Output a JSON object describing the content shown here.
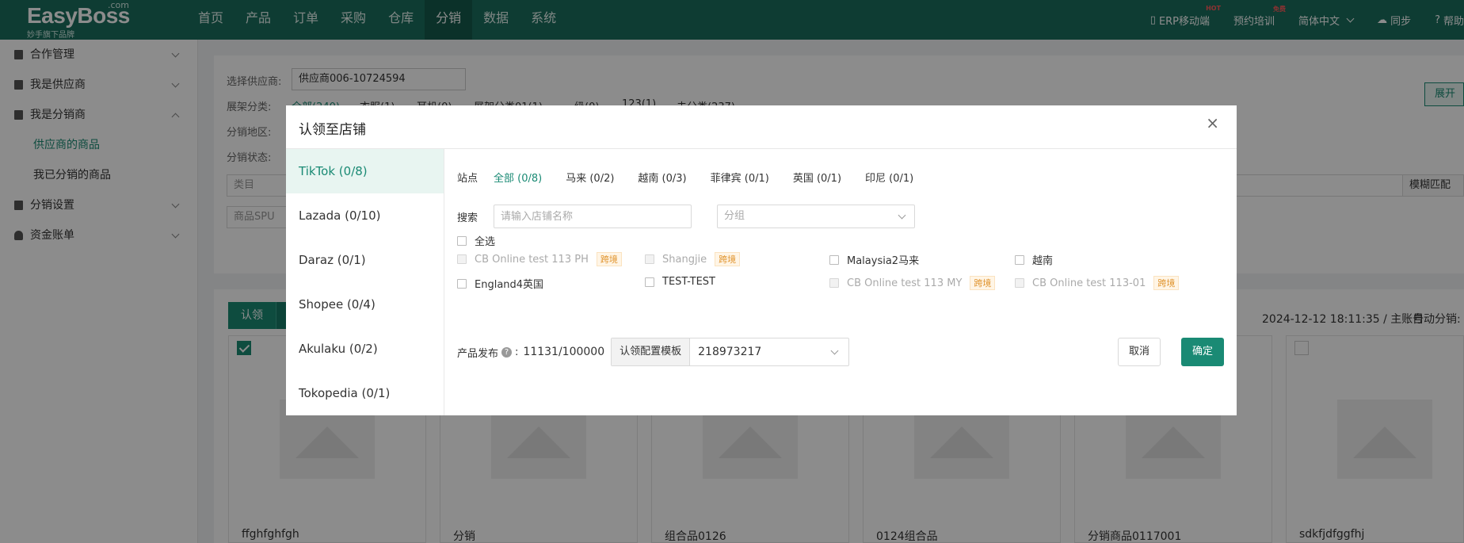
{
  "logo": {
    "brand": "EasyBoss",
    "com": ".com",
    "tagline": "妙手旗下品牌"
  },
  "nav": [
    "首页",
    "产品",
    "订单",
    "采购",
    "仓库",
    "分销",
    "数据",
    "系统"
  ],
  "nav_active": "分销",
  "topright": {
    "erp": "ERP移动端",
    "erp_badge": "HOT",
    "training": "预约培训",
    "training_badge": "免费",
    "language": "简体中文",
    "sync": "同步",
    "help": "帮助"
  },
  "sidebar": {
    "items": [
      {
        "label": "合作管理"
      },
      {
        "label": "我是供应商"
      },
      {
        "label": "我是分销商"
      },
      {
        "label": "分销设置"
      },
      {
        "label": "资金账单"
      }
    ],
    "sub_items": [
      "供应商的商品",
      "我已分销的商品"
    ]
  },
  "filters": {
    "supplier_label": "选择供应商:",
    "supplier_value": "供应商006-10724594",
    "category_label": "展架分类:",
    "category_chips": [
      "全部(240)",
      "衣服(1)",
      "耳机(0)",
      "展架分类01(1)",
      "一级(0)",
      "123(1)",
      "未分类(237)"
    ],
    "region_label": "分销地区:",
    "status_label": "分销状态:",
    "category_field": "类目",
    "spu_field": "商品SPU",
    "fuzzy": "模糊匹配",
    "expand": "展开"
  },
  "list": {
    "claim": "认领",
    "info": "2024-12-12 18:11:35 / 主账号",
    "auto": "自动分销:",
    "products": [
      "ffghfghfgh",
      "分销",
      "组合品0126",
      "0124组合品",
      "分销商品0117001",
      "sdkfjdfggfhj"
    ]
  },
  "modal": {
    "title": "认领至店铺",
    "close": "×",
    "platforms": [
      "TikTok (0/8)",
      "Lazada (0/10)",
      "Daraz (0/1)",
      "Shopee (0/4)",
      "Akulaku (0/2)",
      "Tokopedia (0/1)"
    ],
    "site_label": "站点",
    "sites": [
      "全部 (0/8)",
      "马来 (0/2)",
      "越南 (0/3)",
      "菲律宾 (0/1)",
      "英国 (0/1)",
      "印尼 (0/1)"
    ],
    "search_label": "搜索",
    "search_placeholder": "请输入店铺名称",
    "group_placeholder": "分组",
    "select_all": "全选",
    "shops": [
      {
        "name": "CB Online test 113 PH",
        "tag": "跨境",
        "disabled": true
      },
      {
        "name": "Shangjie",
        "tag": "跨境",
        "disabled": true
      },
      {
        "name": "Malaysia2马来",
        "tag": "",
        "disabled": false
      },
      {
        "name": "越南",
        "tag": "",
        "disabled": false
      },
      {
        "name": "England4英国",
        "tag": "",
        "disabled": false
      },
      {
        "name": "TEST-TEST",
        "tag": "",
        "disabled": false
      },
      {
        "name": "CB Online test 113 MY",
        "tag": "跨境",
        "disabled": true
      },
      {
        "name": "CB Online test 113-01",
        "tag": "跨境",
        "disabled": true
      }
    ],
    "publish_label": "产品发布",
    "publish_sep": ":",
    "publish_count": "11131/100000",
    "template_label": "认领配置模板",
    "template_value": "218973217",
    "cancel": "取消",
    "ok": "确定"
  },
  "colors": {
    "primary": "#1a8a74",
    "header": "#1a6e5e",
    "tag": "#e0942e"
  }
}
